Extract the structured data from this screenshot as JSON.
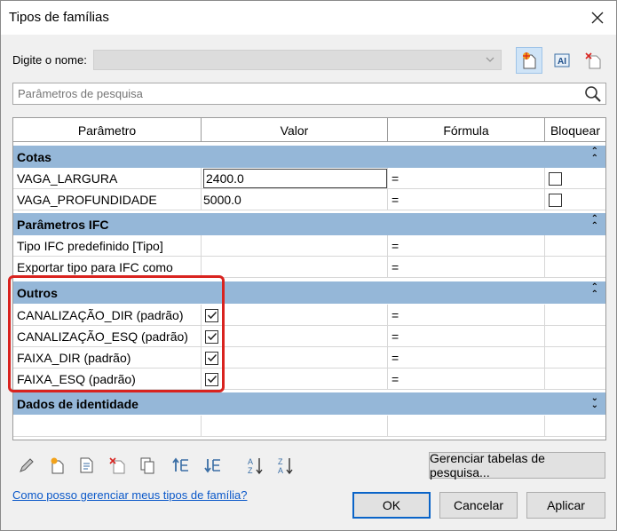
{
  "window": {
    "title": "Tipos de famílias"
  },
  "name_row": {
    "label": "Digite o nome:",
    "value": ""
  },
  "search": {
    "placeholder": "Parâmetros de pesquisa"
  },
  "grid": {
    "columns": [
      "Parâmetro",
      "Valor",
      "Fórmula",
      "Bloquear"
    ],
    "groups": [
      {
        "name": "Cotas",
        "rows": [
          {
            "param": "VAGA_LARGURA",
            "value": "2400.0",
            "formula": "=",
            "lock": "checkbox"
          },
          {
            "param": "VAGA_PROFUNDIDADE",
            "value": "5000.0",
            "formula": "=",
            "lock": "checkbox"
          }
        ]
      },
      {
        "name": "Parâmetros IFC",
        "rows": [
          {
            "param": "Tipo IFC predefinido [Tipo]",
            "value": "",
            "formula": "=",
            "lock": ""
          },
          {
            "param": "Exportar tipo para IFC como",
            "value": "",
            "formula": "=",
            "lock": ""
          }
        ]
      },
      {
        "name": "Outros",
        "rows": [
          {
            "param": "CANALIZAÇÃO_DIR (padrão)",
            "value": "checked",
            "formula": "=",
            "lock": ""
          },
          {
            "param": "CANALIZAÇÃO_ESQ (padrão)",
            "value": "checked",
            "formula": "=",
            "lock": ""
          },
          {
            "param": "FAIXA_DIR (padrão)",
            "value": "checked",
            "formula": "=",
            "lock": ""
          },
          {
            "param": "FAIXA_ESQ (padrão)",
            "value": "checked",
            "formula": "=",
            "lock": ""
          }
        ]
      },
      {
        "name": "Dados de identidade",
        "rows": []
      }
    ]
  },
  "buttons": {
    "manage_lookup": "Gerenciar tabelas de pesquisa...",
    "ok": "OK",
    "cancel": "Cancelar",
    "apply": "Aplicar"
  },
  "help_link": "Como posso gerenciar meus tipos de família?",
  "colors": {
    "group_header": "#95b7d8",
    "highlight": "#d9231f",
    "link": "#0a58c9"
  }
}
